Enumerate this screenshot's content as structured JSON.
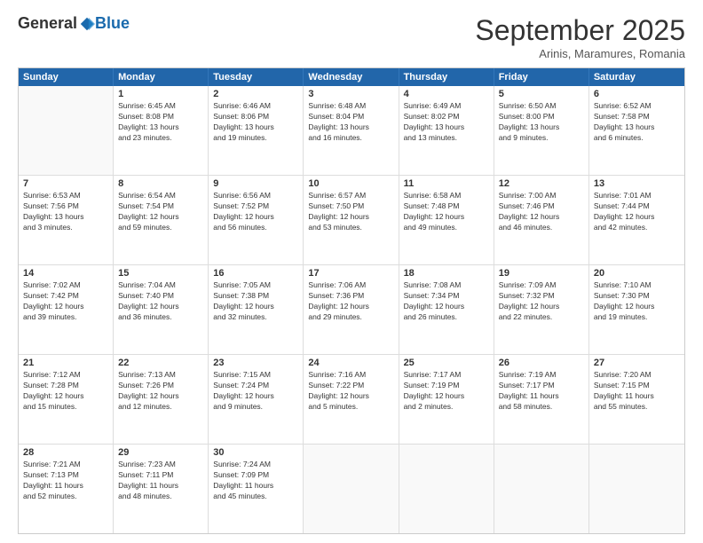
{
  "header": {
    "logo_general": "General",
    "logo_blue": "Blue",
    "month": "September 2025",
    "location": "Arinis, Maramures, Romania"
  },
  "weekdays": [
    "Sunday",
    "Monday",
    "Tuesday",
    "Wednesday",
    "Thursday",
    "Friday",
    "Saturday"
  ],
  "rows": [
    [
      {
        "day": "",
        "info": ""
      },
      {
        "day": "1",
        "info": "Sunrise: 6:45 AM\nSunset: 8:08 PM\nDaylight: 13 hours\nand 23 minutes."
      },
      {
        "day": "2",
        "info": "Sunrise: 6:46 AM\nSunset: 8:06 PM\nDaylight: 13 hours\nand 19 minutes."
      },
      {
        "day": "3",
        "info": "Sunrise: 6:48 AM\nSunset: 8:04 PM\nDaylight: 13 hours\nand 16 minutes."
      },
      {
        "day": "4",
        "info": "Sunrise: 6:49 AM\nSunset: 8:02 PM\nDaylight: 13 hours\nand 13 minutes."
      },
      {
        "day": "5",
        "info": "Sunrise: 6:50 AM\nSunset: 8:00 PM\nDaylight: 13 hours\nand 9 minutes."
      },
      {
        "day": "6",
        "info": "Sunrise: 6:52 AM\nSunset: 7:58 PM\nDaylight: 13 hours\nand 6 minutes."
      }
    ],
    [
      {
        "day": "7",
        "info": "Sunrise: 6:53 AM\nSunset: 7:56 PM\nDaylight: 13 hours\nand 3 minutes."
      },
      {
        "day": "8",
        "info": "Sunrise: 6:54 AM\nSunset: 7:54 PM\nDaylight: 12 hours\nand 59 minutes."
      },
      {
        "day": "9",
        "info": "Sunrise: 6:56 AM\nSunset: 7:52 PM\nDaylight: 12 hours\nand 56 minutes."
      },
      {
        "day": "10",
        "info": "Sunrise: 6:57 AM\nSunset: 7:50 PM\nDaylight: 12 hours\nand 53 minutes."
      },
      {
        "day": "11",
        "info": "Sunrise: 6:58 AM\nSunset: 7:48 PM\nDaylight: 12 hours\nand 49 minutes."
      },
      {
        "day": "12",
        "info": "Sunrise: 7:00 AM\nSunset: 7:46 PM\nDaylight: 12 hours\nand 46 minutes."
      },
      {
        "day": "13",
        "info": "Sunrise: 7:01 AM\nSunset: 7:44 PM\nDaylight: 12 hours\nand 42 minutes."
      }
    ],
    [
      {
        "day": "14",
        "info": "Sunrise: 7:02 AM\nSunset: 7:42 PM\nDaylight: 12 hours\nand 39 minutes."
      },
      {
        "day": "15",
        "info": "Sunrise: 7:04 AM\nSunset: 7:40 PM\nDaylight: 12 hours\nand 36 minutes."
      },
      {
        "day": "16",
        "info": "Sunrise: 7:05 AM\nSunset: 7:38 PM\nDaylight: 12 hours\nand 32 minutes."
      },
      {
        "day": "17",
        "info": "Sunrise: 7:06 AM\nSunset: 7:36 PM\nDaylight: 12 hours\nand 29 minutes."
      },
      {
        "day": "18",
        "info": "Sunrise: 7:08 AM\nSunset: 7:34 PM\nDaylight: 12 hours\nand 26 minutes."
      },
      {
        "day": "19",
        "info": "Sunrise: 7:09 AM\nSunset: 7:32 PM\nDaylight: 12 hours\nand 22 minutes."
      },
      {
        "day": "20",
        "info": "Sunrise: 7:10 AM\nSunset: 7:30 PM\nDaylight: 12 hours\nand 19 minutes."
      }
    ],
    [
      {
        "day": "21",
        "info": "Sunrise: 7:12 AM\nSunset: 7:28 PM\nDaylight: 12 hours\nand 15 minutes."
      },
      {
        "day": "22",
        "info": "Sunrise: 7:13 AM\nSunset: 7:26 PM\nDaylight: 12 hours\nand 12 minutes."
      },
      {
        "day": "23",
        "info": "Sunrise: 7:15 AM\nSunset: 7:24 PM\nDaylight: 12 hours\nand 9 minutes."
      },
      {
        "day": "24",
        "info": "Sunrise: 7:16 AM\nSunset: 7:22 PM\nDaylight: 12 hours\nand 5 minutes."
      },
      {
        "day": "25",
        "info": "Sunrise: 7:17 AM\nSunset: 7:19 PM\nDaylight: 12 hours\nand 2 minutes."
      },
      {
        "day": "26",
        "info": "Sunrise: 7:19 AM\nSunset: 7:17 PM\nDaylight: 11 hours\nand 58 minutes."
      },
      {
        "day": "27",
        "info": "Sunrise: 7:20 AM\nSunset: 7:15 PM\nDaylight: 11 hours\nand 55 minutes."
      }
    ],
    [
      {
        "day": "28",
        "info": "Sunrise: 7:21 AM\nSunset: 7:13 PM\nDaylight: 11 hours\nand 52 minutes."
      },
      {
        "day": "29",
        "info": "Sunrise: 7:23 AM\nSunset: 7:11 PM\nDaylight: 11 hours\nand 48 minutes."
      },
      {
        "day": "30",
        "info": "Sunrise: 7:24 AM\nSunset: 7:09 PM\nDaylight: 11 hours\nand 45 minutes."
      },
      {
        "day": "",
        "info": ""
      },
      {
        "day": "",
        "info": ""
      },
      {
        "day": "",
        "info": ""
      },
      {
        "day": "",
        "info": ""
      }
    ]
  ]
}
